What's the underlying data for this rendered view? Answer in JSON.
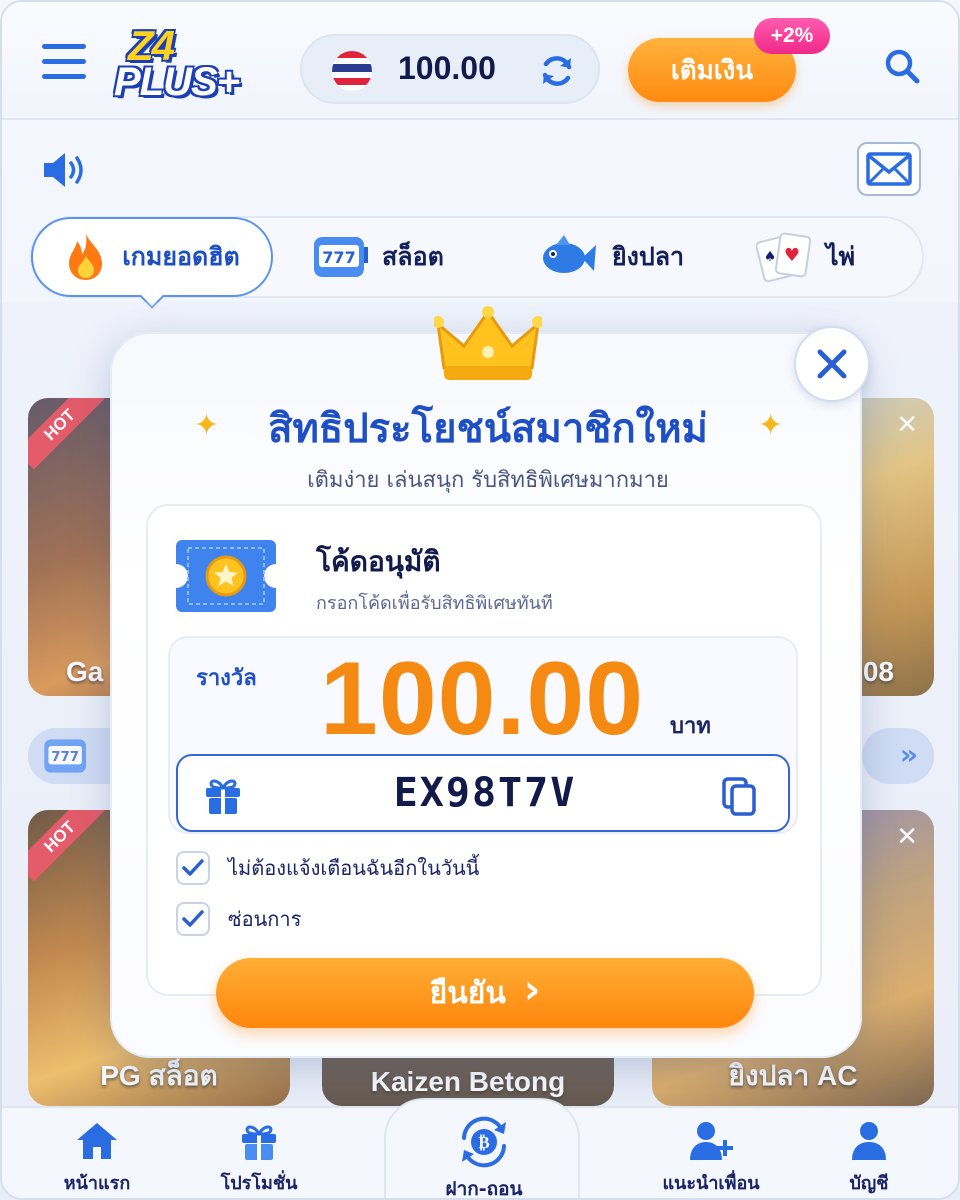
{
  "header": {
    "logo_top": "Z4",
    "logo_bottom": "PLUS+",
    "balance": "100.00",
    "deposit_label": "เติมเงิน",
    "deposit_bonus": "+2%"
  },
  "categories": [
    {
      "label": "เกมยอดฮิต",
      "icon": "fire-icon",
      "active": true
    },
    {
      "label": "สล็อต",
      "icon": "slot-777-icon",
      "active": false
    },
    {
      "label": "ยิงปลา",
      "icon": "fish-icon",
      "active": false
    },
    {
      "label": "ไพ่",
      "icon": "cards-icon",
      "active": false
    }
  ],
  "background_tiles": {
    "hot_tag": "HOT",
    "row1_left_partial": "Ga",
    "row1_right_partial": "08",
    "row2": [
      "PG สล็อต",
      "Kaizen Betong",
      "ยิงปลา AC"
    ]
  },
  "modal": {
    "title": "สิทธิประโยชน์สมาชิกใหม่",
    "subtitle": "เติมง่าย เล่นสนุก รับสิทธิพิเศษมากมาย",
    "card_title": "โค้ดอนุมัติ",
    "card_subtitle": "กรอกโค้ดเพื่อรับสิทธิพิเศษทันที",
    "reward_label": "รางวัล",
    "reward_amount": "100.00",
    "reward_unit": "บาท",
    "code": "EX98T7V",
    "checkbox_1": {
      "label": "ไม่ต้องแจ้งเตือนฉันอีกในวันนี้",
      "checked": true
    },
    "checkbox_2": {
      "label": "ซ่อนการ",
      "checked": true
    },
    "confirm_label": "ยืนยัน",
    "confirm_arrow": "›"
  },
  "bottom_nav": [
    {
      "label": "หน้าแรก",
      "icon": "home-icon"
    },
    {
      "label": "โปรโมชั่น",
      "icon": "gift-icon"
    },
    {
      "label": "ฝาก-ถอน",
      "icon": "bitcoin-exchange-icon"
    },
    {
      "label": "แนะนำเพื่อน",
      "icon": "add-friend-icon"
    },
    {
      "label": "บัญชี",
      "icon": "user-icon"
    }
  ],
  "colors": {
    "primary_blue": "#1f4fc4",
    "accent_orange": "#ff8a10",
    "badge_pink": "#f0288a",
    "navy_text": "#111a4a"
  }
}
